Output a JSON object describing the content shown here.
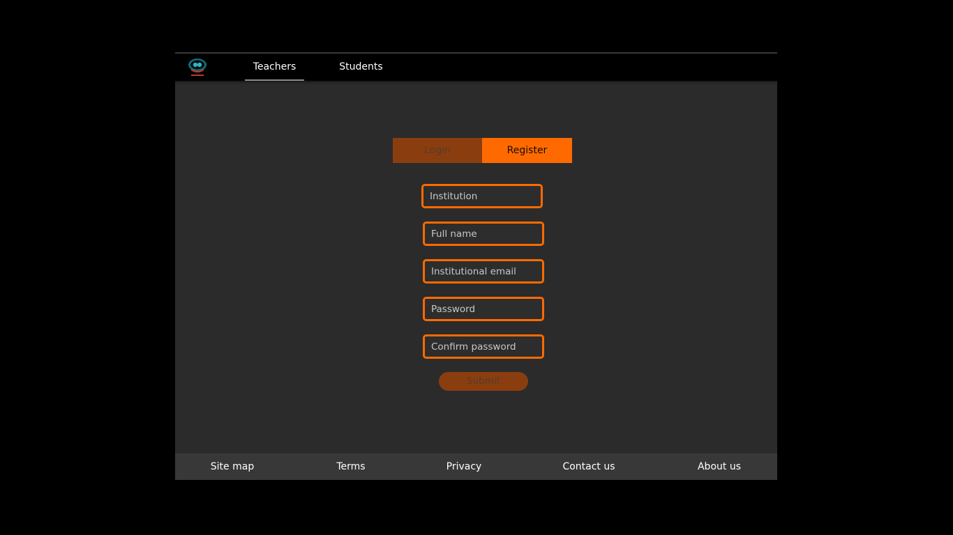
{
  "header": {
    "logo_icon": "brand-logo-icon",
    "tabs": [
      {
        "label": "Teachers",
        "active": true
      },
      {
        "label": "Students",
        "active": false
      }
    ]
  },
  "auth": {
    "login_label": "Login",
    "register_label": "Register",
    "active_tab": "Register"
  },
  "form": {
    "fields": [
      {
        "placeholder": "Institution",
        "value": ""
      },
      {
        "placeholder": "Full name",
        "value": ""
      },
      {
        "placeholder": "Institutional email",
        "value": ""
      },
      {
        "placeholder": "Password",
        "value": ""
      },
      {
        "placeholder": "Confirm password",
        "value": ""
      }
    ],
    "submit_label": "Submit"
  },
  "footer": {
    "links": [
      "Site map",
      "Terms",
      "Privacy",
      "Contact us",
      "About us"
    ]
  },
  "colors": {
    "accent": "#ff6a00",
    "accent_muted": "#8a3e0f",
    "background": "#2b2b2b",
    "nav_background": "#000000",
    "footer_background": "#383838"
  }
}
